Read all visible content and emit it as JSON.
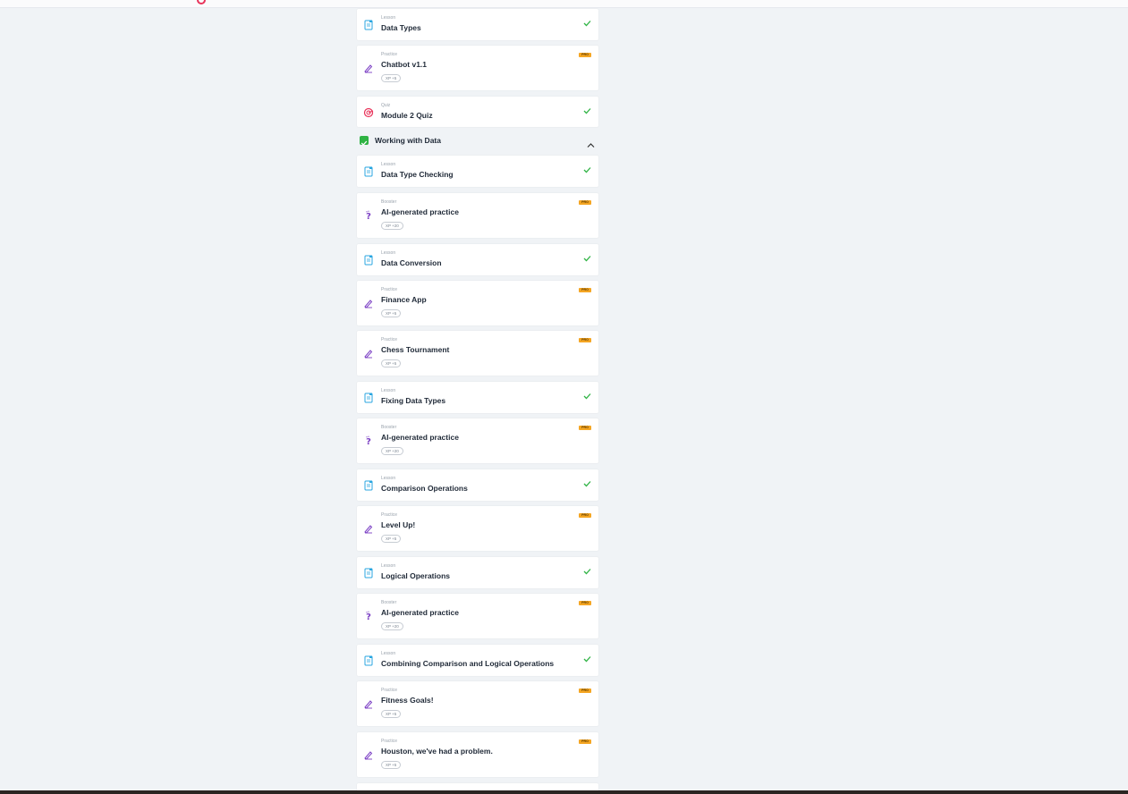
{
  "colors": {
    "background": "#f0f3f6",
    "card": "#ffffff",
    "check": "#2fb344",
    "pro_badge": "#f5a623",
    "lesson_icon": "#2aa6e0",
    "practice_icon": "#7b3fc4",
    "quiz_icon": "#e8335a"
  },
  "module_prev": {
    "items": [
      {
        "kind": "Lesson",
        "title": "Data Types",
        "status": "check",
        "icon": "lesson-icon"
      },
      {
        "kind": "Practice",
        "title": "Chatbot v1.1",
        "status": "pro",
        "xp": "XP +5",
        "icon": "practice-icon"
      },
      {
        "kind": "Quiz",
        "title": "Module 2 Quiz",
        "status": "check",
        "icon": "quiz-icon"
      }
    ]
  },
  "section": {
    "title": "Working with Data",
    "checked": true
  },
  "badges": {
    "pro": "PRO"
  },
  "items": [
    {
      "kind": "Lesson",
      "title": "Data Type Checking",
      "status": "check",
      "icon": "lesson-icon"
    },
    {
      "kind": "Booster",
      "title": "AI-generated practice",
      "status": "pro",
      "xp": "XP +20",
      "icon": "booster-icon"
    },
    {
      "kind": "Lesson",
      "title": "Data Conversion",
      "status": "check",
      "icon": "lesson-icon"
    },
    {
      "kind": "Practice",
      "title": "Finance App",
      "status": "pro",
      "xp": "XP +5",
      "icon": "practice-icon"
    },
    {
      "kind": "Practice",
      "title": "Chess Tournament",
      "status": "pro",
      "xp": "XP +5",
      "icon": "practice-icon"
    },
    {
      "kind": "Lesson",
      "title": "Fixing Data Types",
      "status": "check",
      "icon": "lesson-icon"
    },
    {
      "kind": "Booster",
      "title": "AI-generated practice",
      "status": "pro",
      "xp": "XP +20",
      "icon": "booster-icon"
    },
    {
      "kind": "Lesson",
      "title": "Comparison Operations",
      "status": "check",
      "icon": "lesson-icon"
    },
    {
      "kind": "Practice",
      "title": "Level Up!",
      "status": "pro",
      "xp": "XP +5",
      "icon": "practice-icon"
    },
    {
      "kind": "Lesson",
      "title": "Logical Operations",
      "status": "check",
      "icon": "lesson-icon"
    },
    {
      "kind": "Booster",
      "title": "AI-generated practice",
      "status": "pro",
      "xp": "XP +20",
      "icon": "booster-icon"
    },
    {
      "kind": "Lesson",
      "title": "Combining Comparison and Logical Operations",
      "status": "check",
      "icon": "lesson-icon"
    },
    {
      "kind": "Practice",
      "title": "Fitness Goals!",
      "status": "pro",
      "xp": "XP +5",
      "icon": "practice-icon"
    },
    {
      "kind": "Practice",
      "title": "Houston, we've had a problem.",
      "status": "pro",
      "xp": "XP +5",
      "icon": "practice-icon"
    }
  ]
}
